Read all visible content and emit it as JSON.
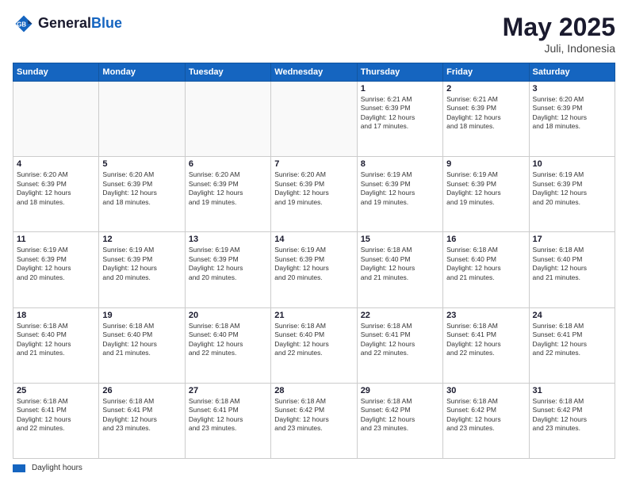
{
  "logo": {
    "line1": "General",
    "line2": "Blue"
  },
  "header": {
    "month": "May 2025",
    "location": "Juli, Indonesia"
  },
  "weekdays": [
    "Sunday",
    "Monday",
    "Tuesday",
    "Wednesday",
    "Thursday",
    "Friday",
    "Saturday"
  ],
  "footer": {
    "swatch_label": "Daylight hours"
  },
  "weeks": [
    [
      {
        "day": "",
        "info": ""
      },
      {
        "day": "",
        "info": ""
      },
      {
        "day": "",
        "info": ""
      },
      {
        "day": "",
        "info": ""
      },
      {
        "day": "1",
        "info": "Sunrise: 6:21 AM\nSunset: 6:39 PM\nDaylight: 12 hours\nand 17 minutes."
      },
      {
        "day": "2",
        "info": "Sunrise: 6:21 AM\nSunset: 6:39 PM\nDaylight: 12 hours\nand 18 minutes."
      },
      {
        "day": "3",
        "info": "Sunrise: 6:20 AM\nSunset: 6:39 PM\nDaylight: 12 hours\nand 18 minutes."
      }
    ],
    [
      {
        "day": "4",
        "info": "Sunrise: 6:20 AM\nSunset: 6:39 PM\nDaylight: 12 hours\nand 18 minutes."
      },
      {
        "day": "5",
        "info": "Sunrise: 6:20 AM\nSunset: 6:39 PM\nDaylight: 12 hours\nand 18 minutes."
      },
      {
        "day": "6",
        "info": "Sunrise: 6:20 AM\nSunset: 6:39 PM\nDaylight: 12 hours\nand 19 minutes."
      },
      {
        "day": "7",
        "info": "Sunrise: 6:20 AM\nSunset: 6:39 PM\nDaylight: 12 hours\nand 19 minutes."
      },
      {
        "day": "8",
        "info": "Sunrise: 6:19 AM\nSunset: 6:39 PM\nDaylight: 12 hours\nand 19 minutes."
      },
      {
        "day": "9",
        "info": "Sunrise: 6:19 AM\nSunset: 6:39 PM\nDaylight: 12 hours\nand 19 minutes."
      },
      {
        "day": "10",
        "info": "Sunrise: 6:19 AM\nSunset: 6:39 PM\nDaylight: 12 hours\nand 20 minutes."
      }
    ],
    [
      {
        "day": "11",
        "info": "Sunrise: 6:19 AM\nSunset: 6:39 PM\nDaylight: 12 hours\nand 20 minutes."
      },
      {
        "day": "12",
        "info": "Sunrise: 6:19 AM\nSunset: 6:39 PM\nDaylight: 12 hours\nand 20 minutes."
      },
      {
        "day": "13",
        "info": "Sunrise: 6:19 AM\nSunset: 6:39 PM\nDaylight: 12 hours\nand 20 minutes."
      },
      {
        "day": "14",
        "info": "Sunrise: 6:19 AM\nSunset: 6:39 PM\nDaylight: 12 hours\nand 20 minutes."
      },
      {
        "day": "15",
        "info": "Sunrise: 6:18 AM\nSunset: 6:40 PM\nDaylight: 12 hours\nand 21 minutes."
      },
      {
        "day": "16",
        "info": "Sunrise: 6:18 AM\nSunset: 6:40 PM\nDaylight: 12 hours\nand 21 minutes."
      },
      {
        "day": "17",
        "info": "Sunrise: 6:18 AM\nSunset: 6:40 PM\nDaylight: 12 hours\nand 21 minutes."
      }
    ],
    [
      {
        "day": "18",
        "info": "Sunrise: 6:18 AM\nSunset: 6:40 PM\nDaylight: 12 hours\nand 21 minutes."
      },
      {
        "day": "19",
        "info": "Sunrise: 6:18 AM\nSunset: 6:40 PM\nDaylight: 12 hours\nand 21 minutes."
      },
      {
        "day": "20",
        "info": "Sunrise: 6:18 AM\nSunset: 6:40 PM\nDaylight: 12 hours\nand 22 minutes."
      },
      {
        "day": "21",
        "info": "Sunrise: 6:18 AM\nSunset: 6:40 PM\nDaylight: 12 hours\nand 22 minutes."
      },
      {
        "day": "22",
        "info": "Sunrise: 6:18 AM\nSunset: 6:41 PM\nDaylight: 12 hours\nand 22 minutes."
      },
      {
        "day": "23",
        "info": "Sunrise: 6:18 AM\nSunset: 6:41 PM\nDaylight: 12 hours\nand 22 minutes."
      },
      {
        "day": "24",
        "info": "Sunrise: 6:18 AM\nSunset: 6:41 PM\nDaylight: 12 hours\nand 22 minutes."
      }
    ],
    [
      {
        "day": "25",
        "info": "Sunrise: 6:18 AM\nSunset: 6:41 PM\nDaylight: 12 hours\nand 22 minutes."
      },
      {
        "day": "26",
        "info": "Sunrise: 6:18 AM\nSunset: 6:41 PM\nDaylight: 12 hours\nand 23 minutes."
      },
      {
        "day": "27",
        "info": "Sunrise: 6:18 AM\nSunset: 6:41 PM\nDaylight: 12 hours\nand 23 minutes."
      },
      {
        "day": "28",
        "info": "Sunrise: 6:18 AM\nSunset: 6:42 PM\nDaylight: 12 hours\nand 23 minutes."
      },
      {
        "day": "29",
        "info": "Sunrise: 6:18 AM\nSunset: 6:42 PM\nDaylight: 12 hours\nand 23 minutes."
      },
      {
        "day": "30",
        "info": "Sunrise: 6:18 AM\nSunset: 6:42 PM\nDaylight: 12 hours\nand 23 minutes."
      },
      {
        "day": "31",
        "info": "Sunrise: 6:18 AM\nSunset: 6:42 PM\nDaylight: 12 hours\nand 23 minutes."
      }
    ]
  ]
}
